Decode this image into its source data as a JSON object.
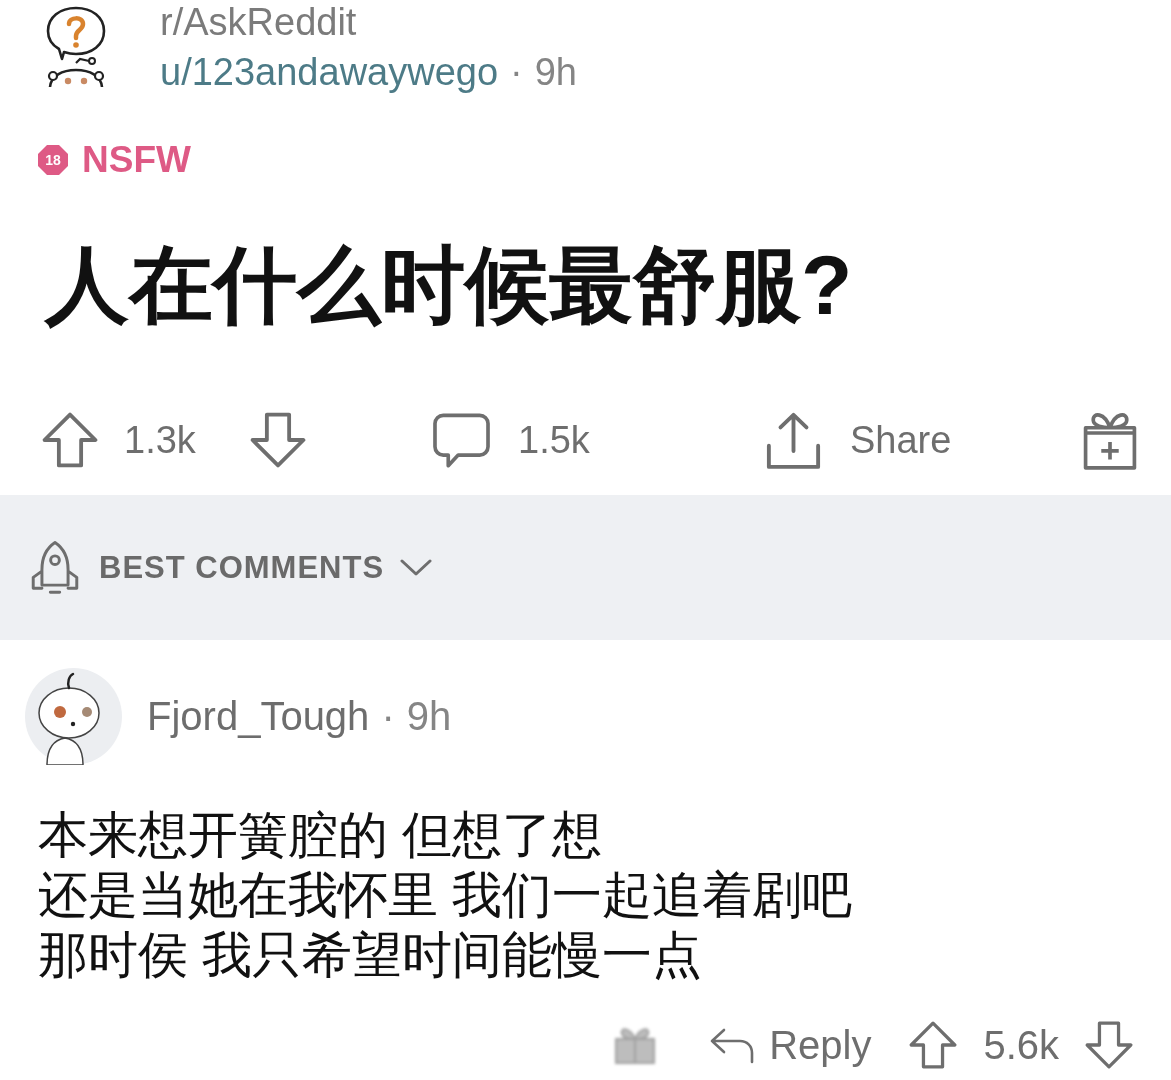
{
  "post": {
    "subreddit": "r/AskReddit",
    "author": "u/123andawaywego",
    "separator": "·",
    "time": "9h",
    "nsfw": {
      "badge": "18",
      "label": "NSFW"
    },
    "title": "人在什么时候最舒服?"
  },
  "post_actions": {
    "upvotes": "1.3k",
    "comments": "1.5k",
    "share": "Share"
  },
  "sort": {
    "label": "BEST COMMENTS"
  },
  "comments": [
    {
      "author": "Fjord_Tough",
      "separator": "·",
      "time": "9h",
      "lines": [
        "本来想开簧腔的 但想了想",
        "还是当她在我怀里 我们一起追着剧吧",
        "那时侯 我只希望时间能慢一点"
      ],
      "reply": "Reply",
      "votes": "5.6k"
    }
  ]
}
